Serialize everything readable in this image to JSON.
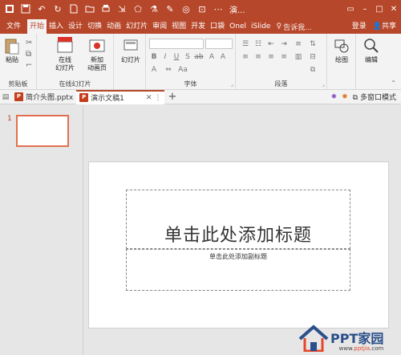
{
  "titlebar": {
    "doc_title": "演..."
  },
  "tabs": [
    {
      "label": "文件"
    },
    {
      "label": "开始"
    },
    {
      "label": "插入"
    },
    {
      "label": "设计"
    },
    {
      "label": "切换"
    },
    {
      "label": "动画"
    },
    {
      "label": "幻灯片"
    },
    {
      "label": "审阅"
    },
    {
      "label": "视图"
    },
    {
      "label": "开发"
    },
    {
      "label": "口袋"
    },
    {
      "label": "Onel"
    },
    {
      "label": "iSlide"
    }
  ],
  "tell_me": "告诉我...",
  "login": "登录",
  "share": "共享",
  "ribbon": {
    "paste": "粘贴",
    "clipboard": "剪贴板",
    "online_slides_line1": "在线",
    "online_slides_line2": "幻灯片",
    "new_slide_line1": "新加",
    "new_slide_line2": "动画页",
    "online_slides_group": "在线幻灯片",
    "slides": "幻灯片",
    "font": "字体",
    "paragraph": "段落",
    "drawing": "绘图",
    "editing": "编辑"
  },
  "doc_tabs": [
    {
      "label": "简介头图.pptx"
    },
    {
      "label": "演示文稿1"
    }
  ],
  "multi_window": "多窗口模式",
  "thumbnail_number": "1",
  "slide": {
    "title_placeholder": "单击此处添加标题",
    "subtitle_placeholder": "单击此处添加副标题"
  },
  "watermark": {
    "brand": "PPT家园",
    "url_prefix": "www.",
    "url_highlight": "pptjia",
    "url_suffix": ".com"
  },
  "colors": {
    "accent": "#b7472a",
    "thumb_border": "#e07050"
  }
}
